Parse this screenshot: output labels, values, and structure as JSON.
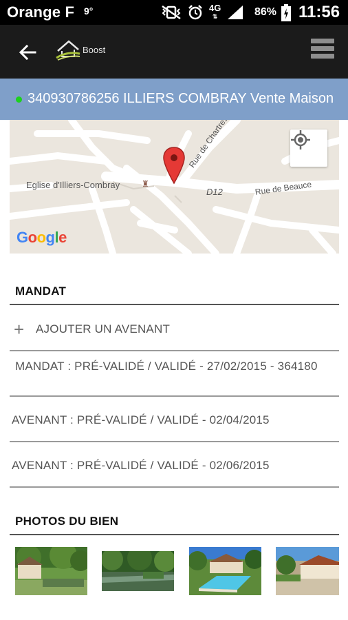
{
  "status_bar": {
    "carrier": "Orange F",
    "temperature": "9°",
    "network": "4G",
    "battery_percent": "86%",
    "time": "11:56"
  },
  "app_bar": {
    "logo_text": "Boost"
  },
  "title_bar": {
    "title": "340930786256 ILLIERS COMBRAY Vente Maison",
    "status_color": "#1dd11d"
  },
  "map": {
    "poi_label": "Eglise d'Illiers-Combray",
    "road_label_1": "Rue de Chartres",
    "road_label_2": "D12",
    "road_label_3": "Rue de Beauce",
    "google_letters": [
      "G",
      "o",
      "o",
      "g",
      "l",
      "e"
    ],
    "google_colors": [
      "#4285f4",
      "#ea4335",
      "#fbbc05",
      "#4285f4",
      "#34a853",
      "#ea4335"
    ]
  },
  "mandat": {
    "header": "MANDAT",
    "add_label": "AJOUTER UN AVENANT",
    "rows": [
      "MANDAT : PRÉ-VALIDÉ / VALIDÉ - 27/02/2015 - 364180",
      "AVENANT : PRÉ-VALIDÉ / VALIDÉ - 02/04/2015",
      "AVENANT : PRÉ-VALIDÉ / VALIDÉ - 02/06/2015"
    ]
  },
  "photos": {
    "header": "PHOTOS DU BIEN"
  },
  "colors": {
    "title_bar_bg": "#7f9fc9",
    "app_bar_bg": "#1b1b1b",
    "marker": "#e53935"
  }
}
